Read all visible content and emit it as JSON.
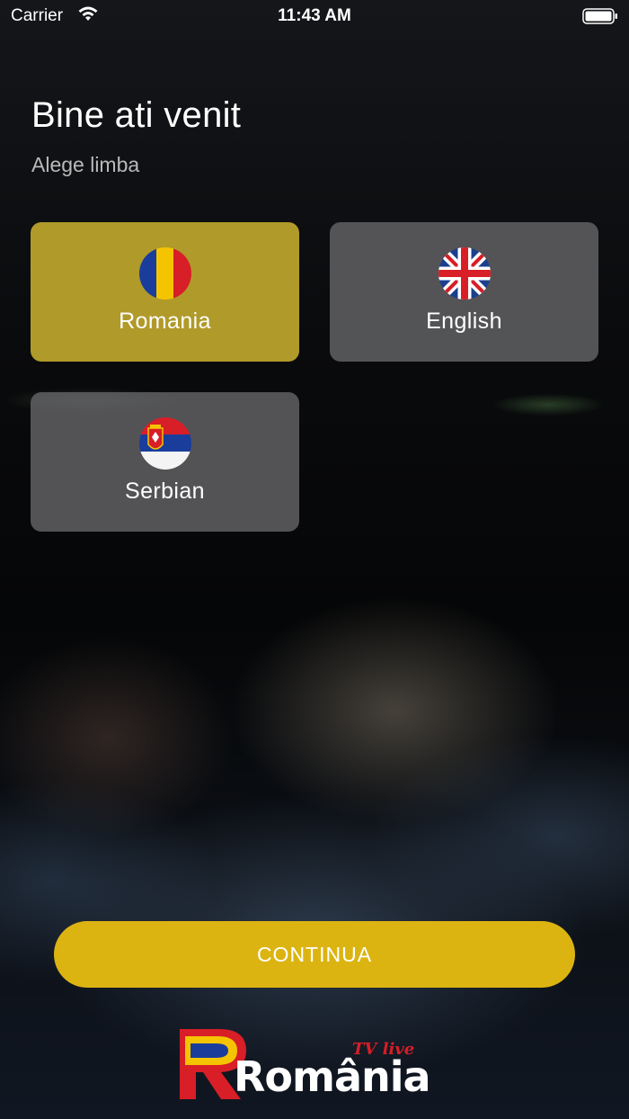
{
  "status_bar": {
    "carrier": "Carrier",
    "time": "11:43 AM"
  },
  "header": {
    "title": "Bine ati venit",
    "subtitle": "Alege limba"
  },
  "languages": [
    {
      "label": "Romania",
      "flag": "romania-flag-icon",
      "selected": true
    },
    {
      "label": "English",
      "flag": "uk-flag-icon",
      "selected": false
    },
    {
      "label": "Serbian",
      "flag": "serbia-flag-icon",
      "selected": false
    }
  ],
  "continue_button": {
    "label": "CONTINUA"
  },
  "logo": {
    "word": "România",
    "tagline": "TV live"
  },
  "colors": {
    "selected_card": "#b09a2a",
    "card": "#646466",
    "button": "#dcb412",
    "logo_red": "#d81e27",
    "logo_yellow": "#f5c400",
    "logo_blue": "#1a3d9c"
  }
}
